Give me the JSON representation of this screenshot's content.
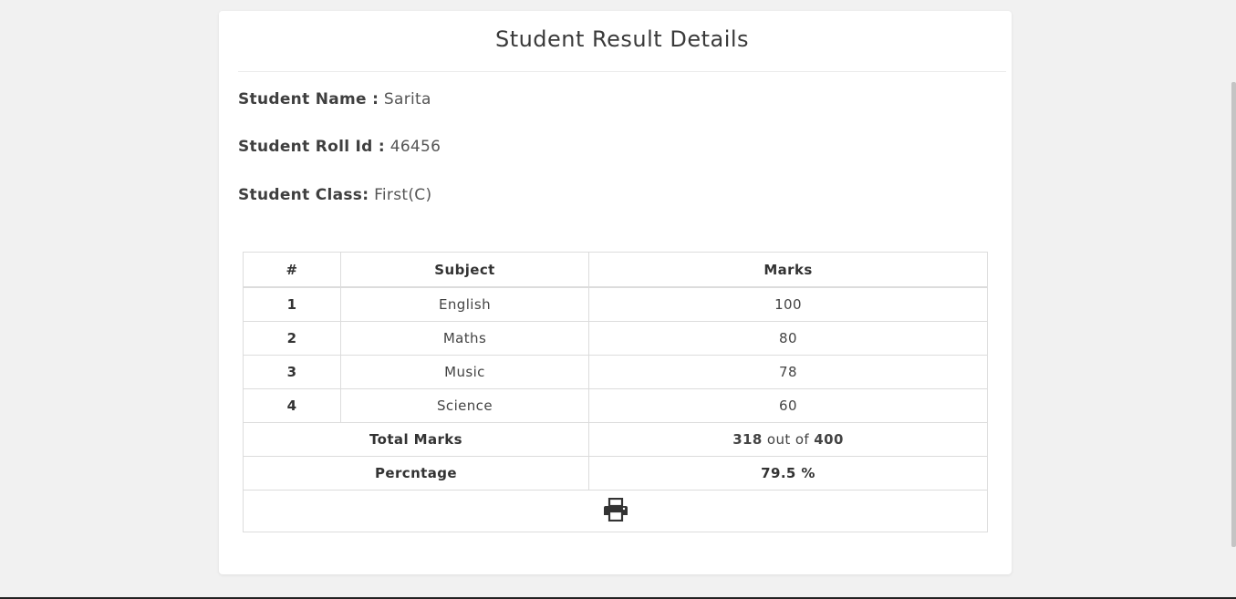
{
  "card": {
    "title": "Student Result Details"
  },
  "student": {
    "name_label": "Student Name :",
    "name_value": "Sarita",
    "roll_label": "Student Roll Id :",
    "roll_value": "46456",
    "class_label": "Student Class:",
    "class_value": "First(C)"
  },
  "table": {
    "headers": [
      "#",
      "Subject",
      "Marks"
    ],
    "rows": [
      {
        "index": "1",
        "subject": "English",
        "marks": "100"
      },
      {
        "index": "2",
        "subject": "Maths",
        "marks": "80"
      },
      {
        "index": "3",
        "subject": "Music",
        "marks": "78"
      },
      {
        "index": "4",
        "subject": "Science",
        "marks": "60"
      }
    ],
    "total_label": "Total Marks",
    "total_obtained": "318",
    "total_out_of_text": "out of",
    "total_max": "400",
    "percentage_label": "Percntage",
    "percentage_value": "79.5 %"
  },
  "icons": {
    "print": "print-icon"
  },
  "colors": {
    "background": "#f1f1f1",
    "card": "#ffffff",
    "border": "#dcdcdc",
    "text": "#444444"
  }
}
